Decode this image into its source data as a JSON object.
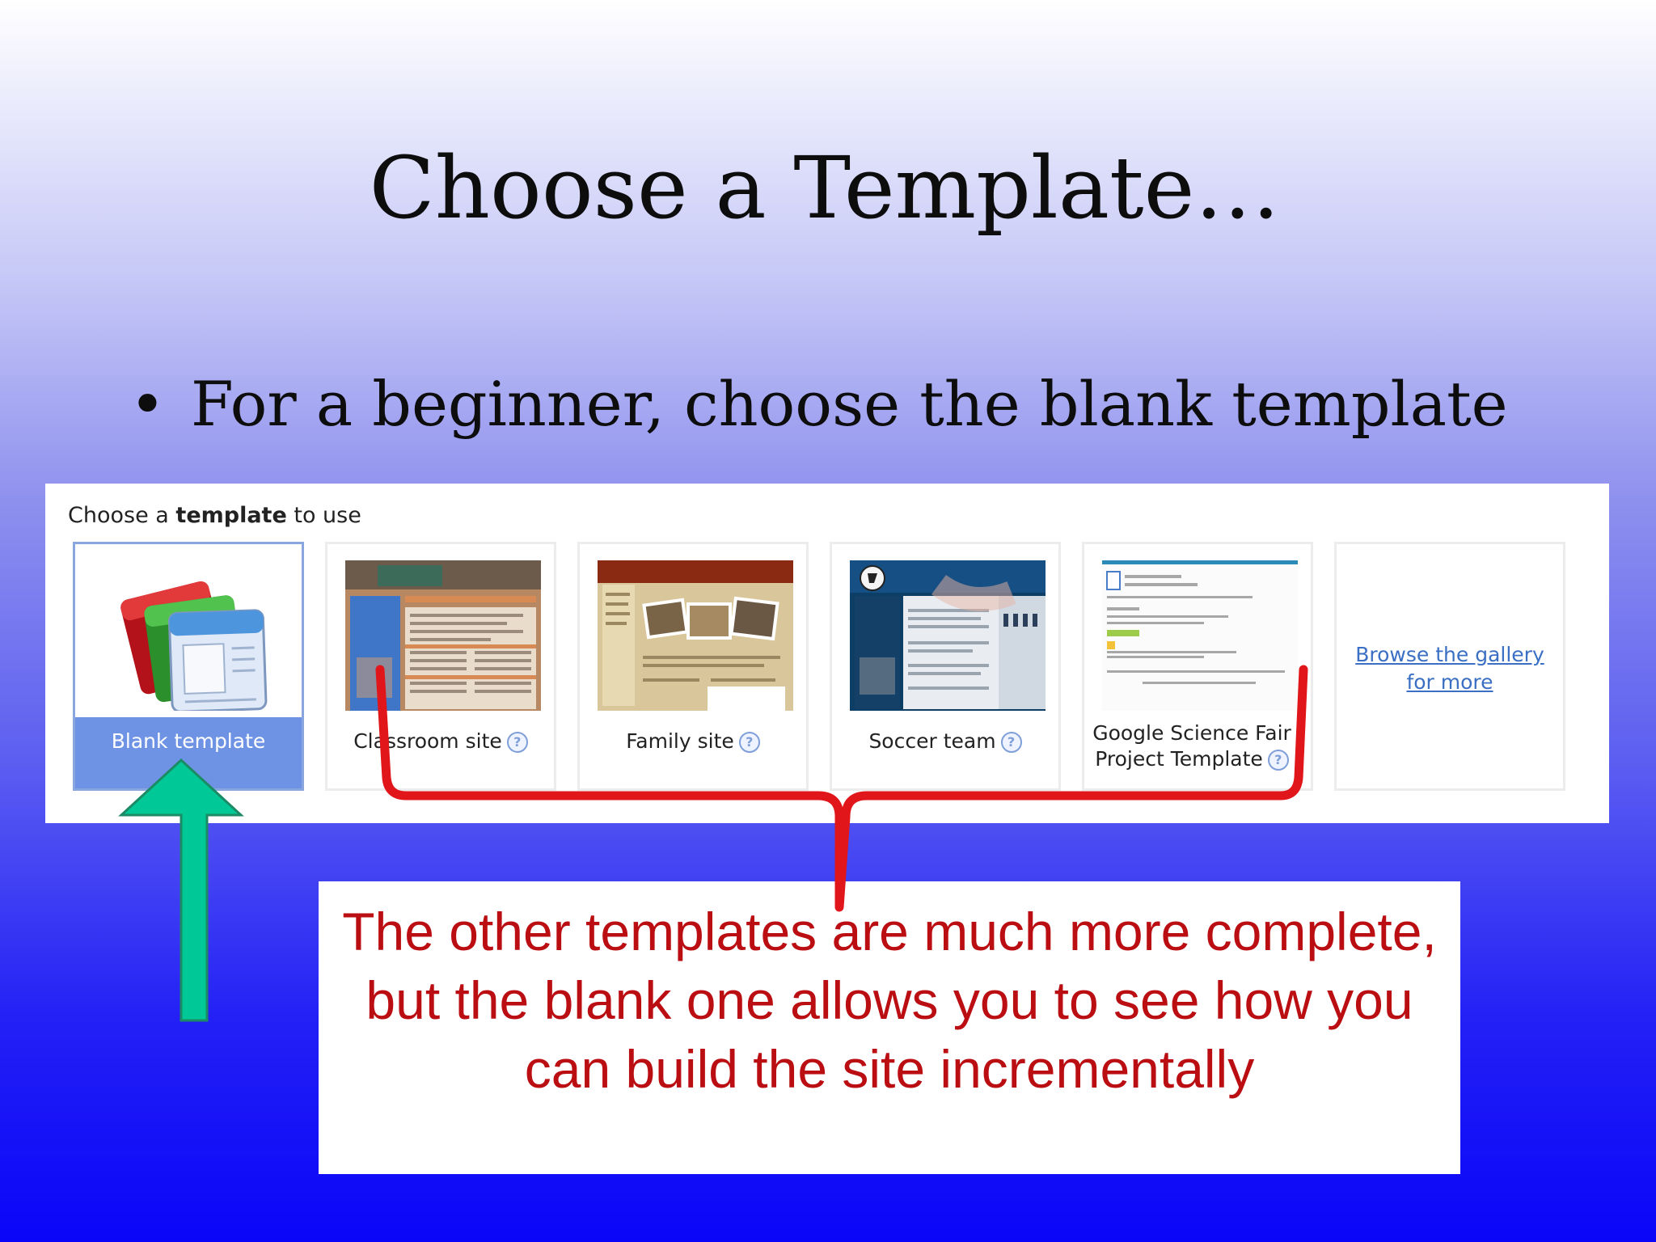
{
  "slide": {
    "title": "Choose a Template…",
    "bullet_symbol": "•",
    "bullet": "For a beginner, choose the blank template"
  },
  "chooser": {
    "heading_pre": "Choose a ",
    "heading_bold": "template",
    "heading_post": " to use",
    "cards": [
      {
        "label": "Blank template",
        "icon": "stacked-pages-icon",
        "selected": true
      },
      {
        "label": "Classroom site",
        "icon": "help-icon"
      },
      {
        "label": "Family site",
        "icon": "help-icon"
      },
      {
        "label": "Soccer team",
        "icon": "help-icon"
      },
      {
        "label": "Google Science Fair Project Template",
        "icon": "help-icon"
      }
    ],
    "help_glyph": "?",
    "gallery_link": "Browse the gallery for more"
  },
  "callout": {
    "text": "The other templates are much more complete, but the blank one allows you to see how you can build the site incrementally"
  },
  "colors": {
    "arrow": "#00c896",
    "brace": "#e0161a",
    "callout_text": "#bb0e12",
    "selected_card": "#6f93e4"
  }
}
